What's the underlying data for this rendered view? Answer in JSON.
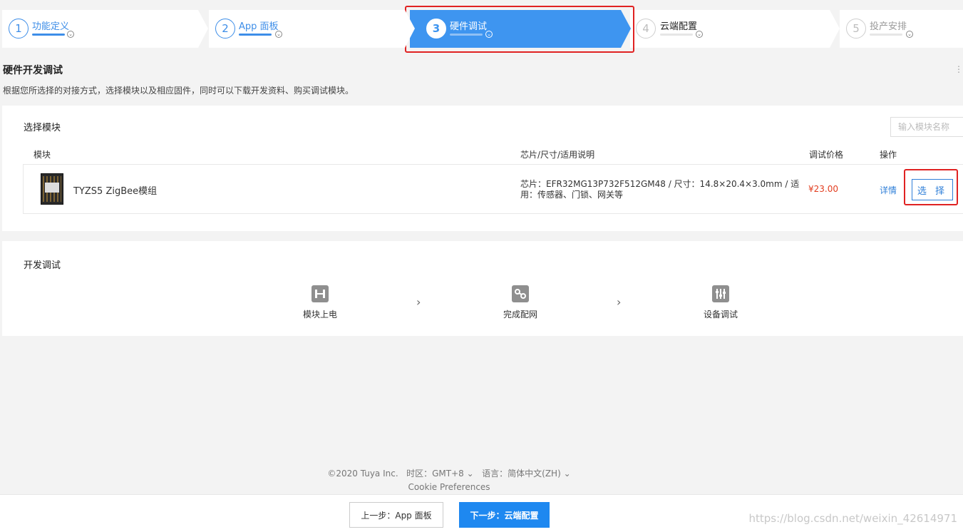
{
  "steps": [
    {
      "num": "1",
      "label": "功能定义"
    },
    {
      "num": "2",
      "label": "App 面板"
    },
    {
      "num": "3",
      "label": "硬件调试"
    },
    {
      "num": "4",
      "label": "云端配置"
    },
    {
      "num": "5",
      "label": "投产安排"
    }
  ],
  "page": {
    "title": "硬件开发调试",
    "description": "根据您所选择的对接方式，选择模块以及相应固件，同时可以下载开发资料、购买调试模块。"
  },
  "module_card": {
    "title": "选择模块",
    "search_placeholder": "输入模块名称",
    "columns": [
      "模块",
      "芯片/尺寸/适用说明",
      "调试价格",
      "操作"
    ],
    "rows": [
      {
        "name": "TYZS5 ZigBee模组",
        "desc": "芯片：EFR32MG13P732F512GM48 / 尺寸：14.8×20.4×3.0mm / 适用：传感器、门锁、网关等",
        "price": "¥23.00",
        "detail": "详情",
        "select": "选 择"
      }
    ]
  },
  "dev_card": {
    "title": "开发调试",
    "steps": [
      "模块上电",
      "完成配网",
      "设备调试"
    ]
  },
  "footer": {
    "copyright": "©2020 Tuya Inc.",
    "timezone": "时区：GMT+8",
    "language": "语言：简体中文(ZH)",
    "cookie": "Cookie Preferences"
  },
  "bottom": {
    "prev": "上一步：App 面板",
    "next": "下一步：云端配置",
    "watermark": "https://blog.csdn.net/weixin_42614971"
  },
  "colors": {
    "accent": "#3e95f0",
    "price": "#e23c1e",
    "highlight_box": "#e02222"
  }
}
